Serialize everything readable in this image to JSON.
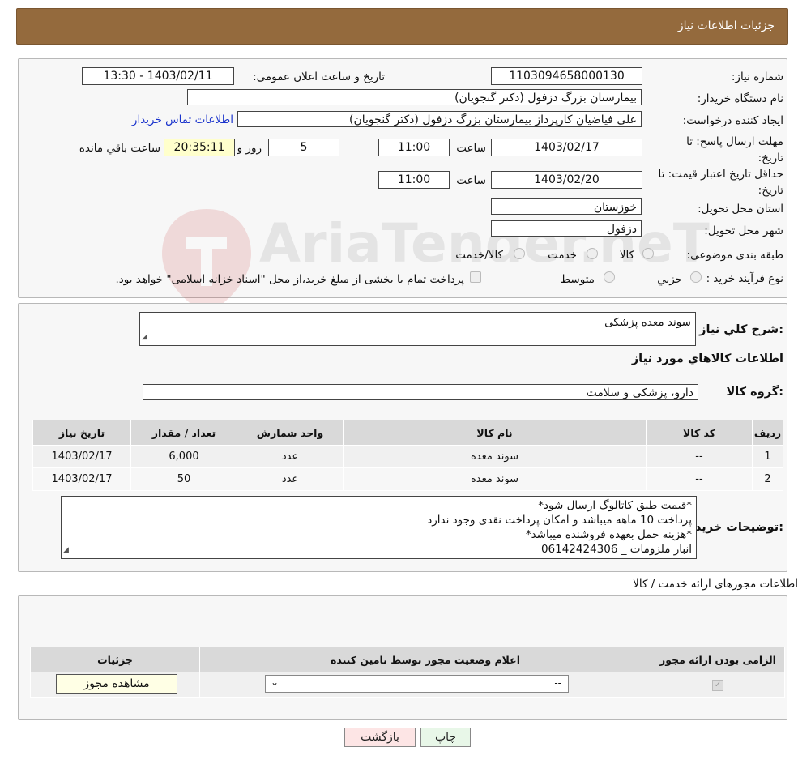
{
  "header": {
    "title": "جزئیات اطلاعات نیاز"
  },
  "form": {
    "need_number_label": "شماره نیاز:",
    "need_number": "1103094658000130",
    "announce_label": "تاریخ و ساعت اعلان عمومی:",
    "announce_value": "1403/02/11 - 13:30",
    "buyer_org_label": "نام دستگاه خریدار:",
    "buyer_org": "بیمارستان بزرگ دزفول (دکتر گنجویان)",
    "creator_label": "ایجاد کننده درخواست:",
    "creator": "علی فیاضیان کارپرداز بیمارستان بزرگ دزفول (دکتر گنجویان)",
    "contact_link": "اطلاعات تماس خریدار",
    "reply_deadline_label": "مهلت ارسال پاسخ: تا تاریخ:",
    "reply_date": "1403/02/17",
    "time_label": "ساعت",
    "reply_time": "11:00",
    "days_value": "5",
    "days_label": "روز و",
    "remaining_time": "20:35:11",
    "remaining_label": "ساعت باقي مانده",
    "price_validity_label": "حداقل تاریخ اعتبار قیمت: تا تاریخ:",
    "price_date": "1403/02/20",
    "price_time": "11:00",
    "province_label": "استان محل تحویل:",
    "province": "خوزستان",
    "city_label": "شهر محل تحویل:",
    "city": "دزفول",
    "category_label": "طبقه بندی موضوعی:",
    "category_options": [
      "کالا",
      "خدمت",
      "کالا/خدمت"
    ],
    "process_label": "نوع فرآیند خرید :",
    "process_options": [
      "جزیي",
      "متوسط"
    ],
    "process_note": "پرداخت تمام یا بخشی از مبلغ خرید،از محل \"اسناد خزانه اسلامی\" خواهد بود."
  },
  "summary": {
    "desc_label": "شرح کلي نیاز:",
    "desc_value": "سوند معده پزشکی",
    "goods_heading": "اطلاعات کالاهاي مورد نیاز",
    "group_label": "گروه کالا:",
    "group_value": "دارو، پزشکی و سلامت",
    "table": {
      "headers": [
        "ردیف",
        "کد کالا",
        "نام کالا",
        "واحد شمارش",
        "تعداد / مقدار",
        "تاریخ نیاز"
      ],
      "rows": [
        [
          "1",
          "--",
          "سوند معده",
          "عدد",
          "6,000",
          "1403/02/17"
        ],
        [
          "2",
          "--",
          "سوند معده",
          "عدد",
          "50",
          "1403/02/17"
        ]
      ]
    },
    "buyer_notes_label": "توضیحات خریدار:",
    "buyer_notes": [
      "*قیمت طبق کاتالوگ ارسال شود*",
      "پرداخت 10 ماهه میباشد و امکان پرداخت نقدی وجود ندارد",
      "*هزینه حمل بعهده فروشنده میباشد*",
      "انبار ملزومات _ 06142424306"
    ]
  },
  "permits": {
    "title": "اطلاعات مجوزهای ارائه خدمت / کالا",
    "headers": [
      "الزامی بودن ارائه مجوز",
      "اعلام وضعیت مجوز توسط تامین کننده",
      "جزئیات"
    ],
    "select_value": "--",
    "view_button": "مشاهده مجوز"
  },
  "actions": {
    "print": "چاپ",
    "back": "بازگشت"
  },
  "watermark": {
    "text": "AriaTender.neT"
  }
}
